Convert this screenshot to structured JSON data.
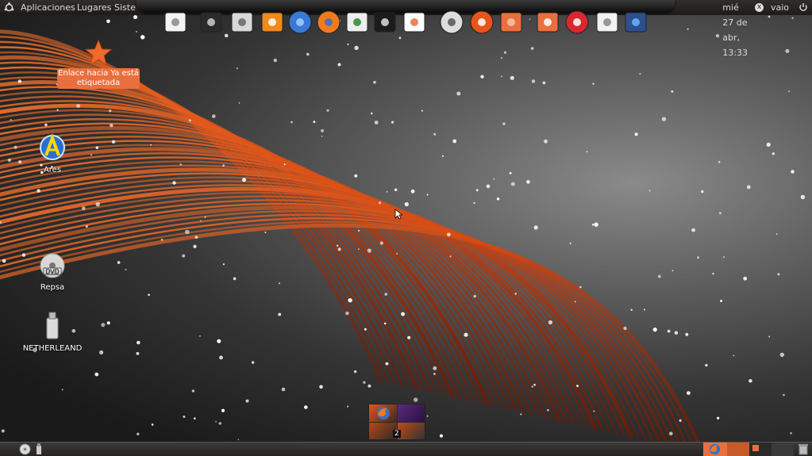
{
  "top_panel": {
    "menus": [
      "Aplicaciones",
      "Lugares",
      "Siste"
    ],
    "clock": "mié 27 de abr, 13:33",
    "user": "vaio"
  },
  "desktop": {
    "tooltip": "Enlace hacia Ya está etiquetada",
    "icons": [
      {
        "label": "Ares",
        "icon": "ares-icon"
      },
      {
        "label": "Repsa",
        "icon": "dvd-icon"
      },
      {
        "label": "NETHERLEAND",
        "icon": "usb-drive-icon"
      }
    ]
  },
  "dock": {
    "items": [
      "text-editor-icon",
      "terminal-icon",
      "calculator-icon",
      "vlc-icon",
      "messenger-icon",
      "firefox-icon",
      "network-icon",
      "eclipse-icon",
      "screenshot-icon",
      "search-icon",
      "ubuntu-icon",
      "files-icon",
      "downloads-folder-icon",
      "power-icon",
      "mail-icon",
      "pointer-icon"
    ]
  },
  "workspace_pager": {
    "active_label": "2"
  },
  "colors": {
    "accent": "#e9703e",
    "panel": "#2a2926",
    "feather": "#e0561a"
  }
}
